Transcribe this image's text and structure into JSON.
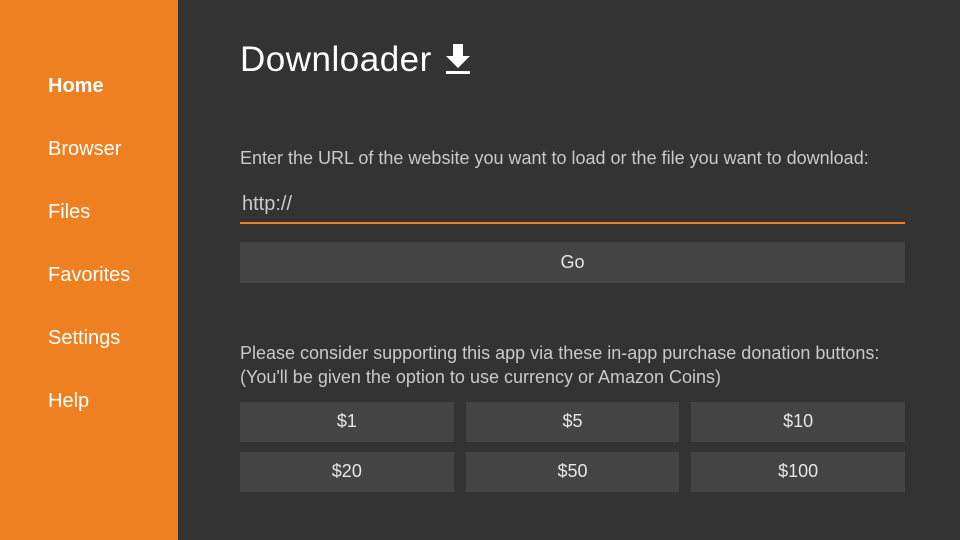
{
  "app": {
    "title": "Downloader"
  },
  "sidebar": {
    "items": [
      {
        "label": "Home",
        "active": true
      },
      {
        "label": "Browser",
        "active": false
      },
      {
        "label": "Files",
        "active": false
      },
      {
        "label": "Favorites",
        "active": false
      },
      {
        "label": "Settings",
        "active": false
      },
      {
        "label": "Help",
        "active": false
      }
    ]
  },
  "main": {
    "instruction": "Enter the URL of the website you want to load or the file you want to download:",
    "url_value": "http://",
    "go_label": "Go",
    "donation_line1": "Please consider supporting this app via these in-app purchase donation buttons:",
    "donation_line2": "(You'll be given the option to use currency or Amazon Coins)",
    "donation_buttons": [
      "$1",
      "$5",
      "$10",
      "$20",
      "$50",
      "$100"
    ]
  }
}
